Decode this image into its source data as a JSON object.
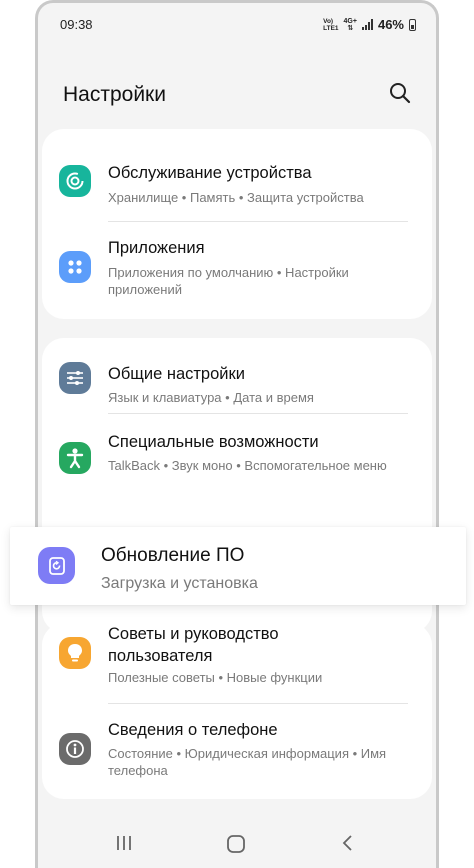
{
  "status_bar": {
    "time": "09:38",
    "network_top": "Vo)",
    "network_bottom": "LTE1",
    "network_gen": "4G+",
    "battery": "46%"
  },
  "header": {
    "title": "Настройки"
  },
  "items": [
    {
      "title": "Обслуживание устройства",
      "subtitle": "Хранилище • Память • Защита устройства",
      "icon": "device-care-icon",
      "color": "#17b59c"
    },
    {
      "title": "Приложения",
      "subtitle": "Приложения по умолчанию • Настройки приложений",
      "icon": "apps-icon",
      "color": "#5c9dfa"
    },
    {
      "title": "Общие настройки",
      "subtitle": "Язык и клавиатура • Дата и время",
      "icon": "sliders-icon",
      "color": "#5f7b98"
    },
    {
      "title": "Специальные возможности",
      "subtitle": "TalkBack • Звук моно • Вспомогательное меню",
      "icon": "accessibility-icon",
      "color": "#26a860"
    },
    {
      "title": "Обновление ПО",
      "subtitle": "Загрузка и установка",
      "icon": "software-update-icon",
      "color": "#7e7cf5"
    },
    {
      "title": "Советы и руководство пользователя",
      "subtitle": "Полезные советы • Новые функции",
      "icon": "lightbulb-icon",
      "color": "#f7a631"
    },
    {
      "title": "Сведения о телефоне",
      "subtitle": "Состояние • Юридическая информация • Имя телефона",
      "icon": "info-icon",
      "color": "#6b6b6b"
    }
  ],
  "nav": {
    "recents": "recents-icon",
    "home": "home-icon",
    "back": "back-icon"
  }
}
